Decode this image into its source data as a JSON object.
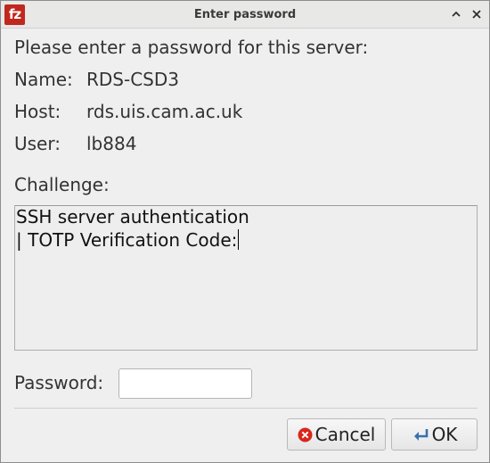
{
  "window": {
    "title": "Enter password",
    "app_logo_text": "fz"
  },
  "dialog": {
    "prompt": "Please enter a password for this server:",
    "fields": [
      {
        "key": "Name:",
        "value": "RDS-CSD3"
      },
      {
        "key": "Host:",
        "value": "rds.uis.cam.ac.uk"
      },
      {
        "key": "User:",
        "value": "lb884"
      }
    ],
    "challenge_label": "Challenge:",
    "challenge_lines": [
      "SSH server authentication",
      "| TOTP Verification Code:"
    ],
    "password_label": "Password:",
    "password_value": ""
  },
  "buttons": {
    "cancel_label": "Cancel",
    "ok_label": "OK"
  },
  "icons": {
    "collapse": "chevron-up-icon",
    "close": "close-icon",
    "cancel": "cancel-icon",
    "ok": "enter-arrow-icon"
  },
  "colors": {
    "logo_red": "#c0281e",
    "cancel_red": "#d9261c",
    "ok_blue": "#3a6fb0"
  }
}
